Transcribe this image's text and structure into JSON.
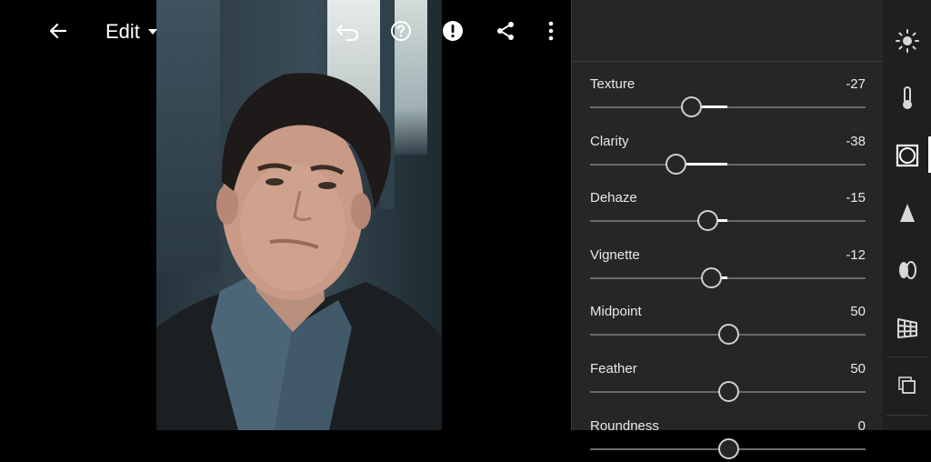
{
  "toolbar": {
    "mode_label": "Edit"
  },
  "panel": {
    "section": "Effects",
    "sliders": [
      {
        "name": "Texture",
        "value": "-27",
        "level": -27
      },
      {
        "name": "Clarity",
        "value": "-38",
        "level": -38
      },
      {
        "name": "Dehaze",
        "value": "-15",
        "level": -15
      },
      {
        "name": "Vignette",
        "value": "-12",
        "level": -12
      },
      {
        "name": "Midpoint",
        "value": "50",
        "level": 0
      },
      {
        "name": "Feather",
        "value": "50",
        "level": 0
      },
      {
        "name": "Roundness",
        "value": "0",
        "level": 0
      }
    ]
  },
  "rail": {
    "tools": [
      "light-icon",
      "color-icon",
      "effects-icon",
      "detail-icon",
      "optics-icon",
      "geometry-icon",
      "versions-icon"
    ],
    "active": "effects-icon"
  },
  "colors": {
    "panel_bg": "#262626",
    "rail_bg": "#1f1f1f",
    "accent": "#ffffff"
  }
}
